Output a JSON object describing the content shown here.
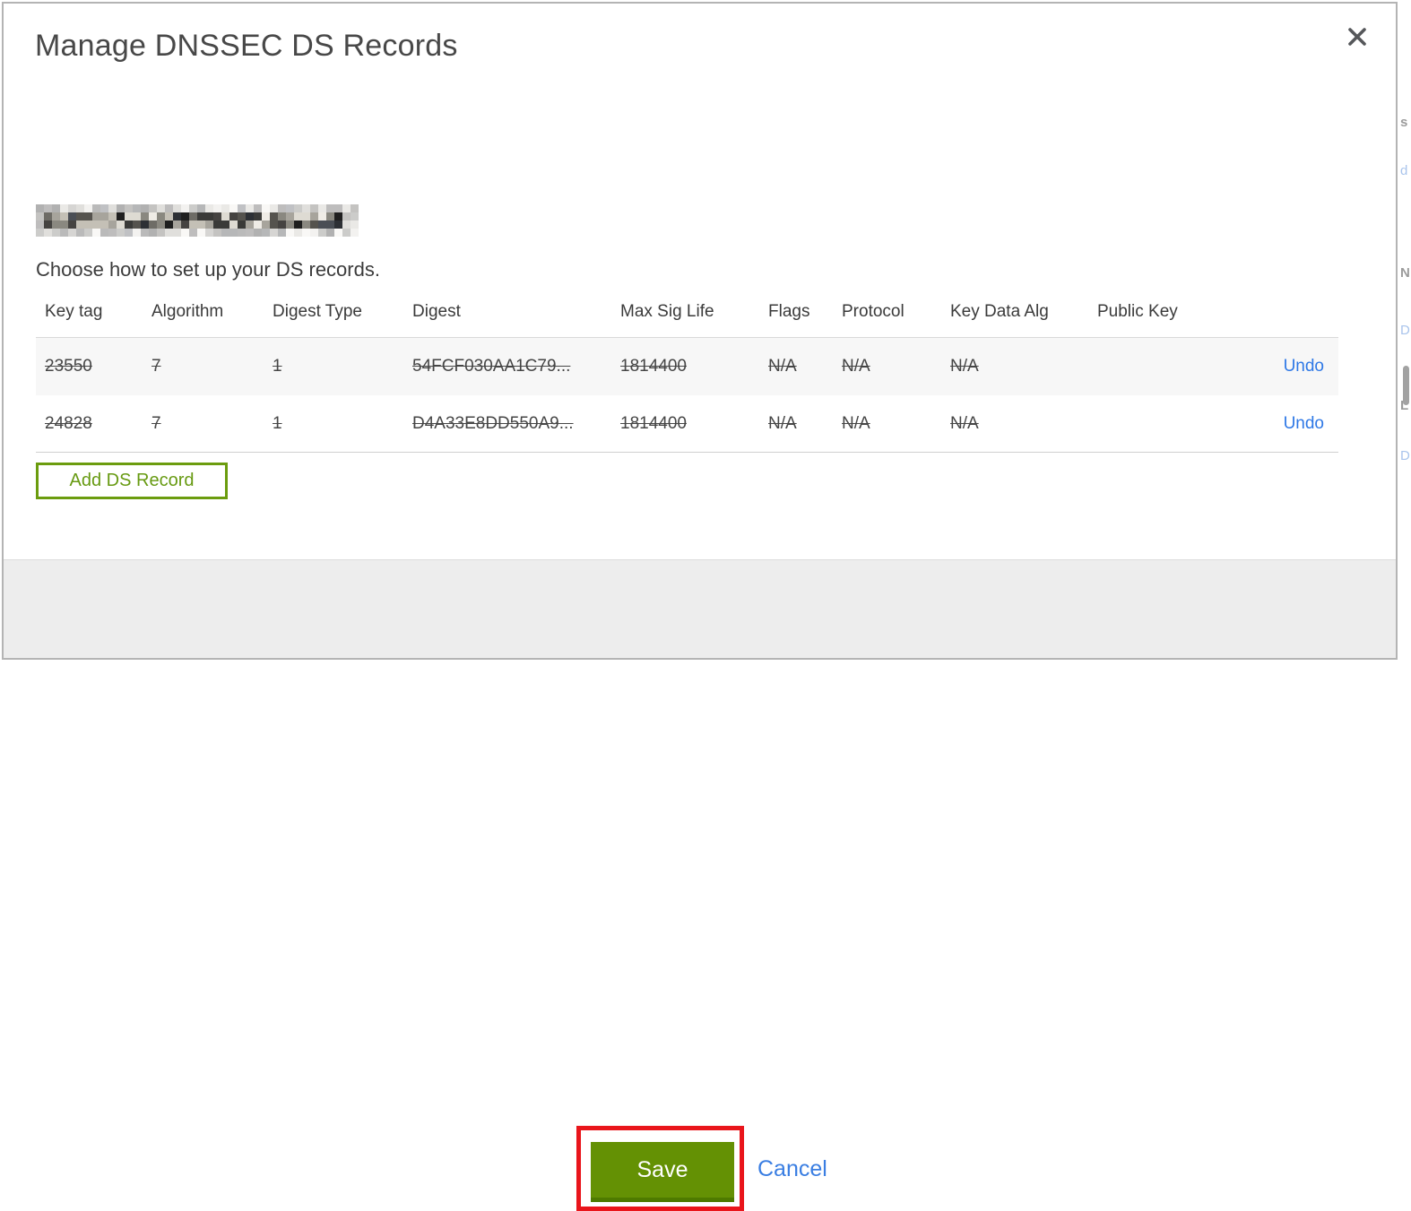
{
  "modal": {
    "title": "Manage DNSSEC DS Records",
    "subtitle": "Choose how to set up your DS records.",
    "table": {
      "headers": [
        "Key tag",
        "Algorithm",
        "Digest Type",
        "Digest",
        "Max Sig Life",
        "Flags",
        "Protocol",
        "Key Data Alg",
        "Public Key"
      ],
      "rows": [
        {
          "key_tag": "23550",
          "algorithm": "7",
          "digest_type": "1",
          "digest": "54FCF030AA1C79...",
          "max_sig_life": "1814400",
          "flags": "N/A",
          "protocol": "N/A",
          "key_data_alg": "N/A",
          "public_key": "",
          "action": "Undo",
          "state": "marked-for-deletion"
        },
        {
          "key_tag": "24828",
          "algorithm": "7",
          "digest_type": "1",
          "digest": "D4A33E8DD550A9...",
          "max_sig_life": "1814400",
          "flags": "N/A",
          "protocol": "N/A",
          "key_data_alg": "N/A",
          "public_key": "",
          "action": "Undo",
          "state": "marked-for-deletion"
        }
      ]
    },
    "add_button_label": "Add DS Record",
    "footer": {
      "save_label": "Save",
      "cancel_label": "Cancel"
    }
  },
  "colors": {
    "primary_green": "#649104",
    "outline_green": "#6b9c0e",
    "link_blue": "#2e78e6",
    "annotation_red": "#e9151b",
    "row_stripe": "#f7f7f7",
    "footer_gray": "#ededed"
  }
}
